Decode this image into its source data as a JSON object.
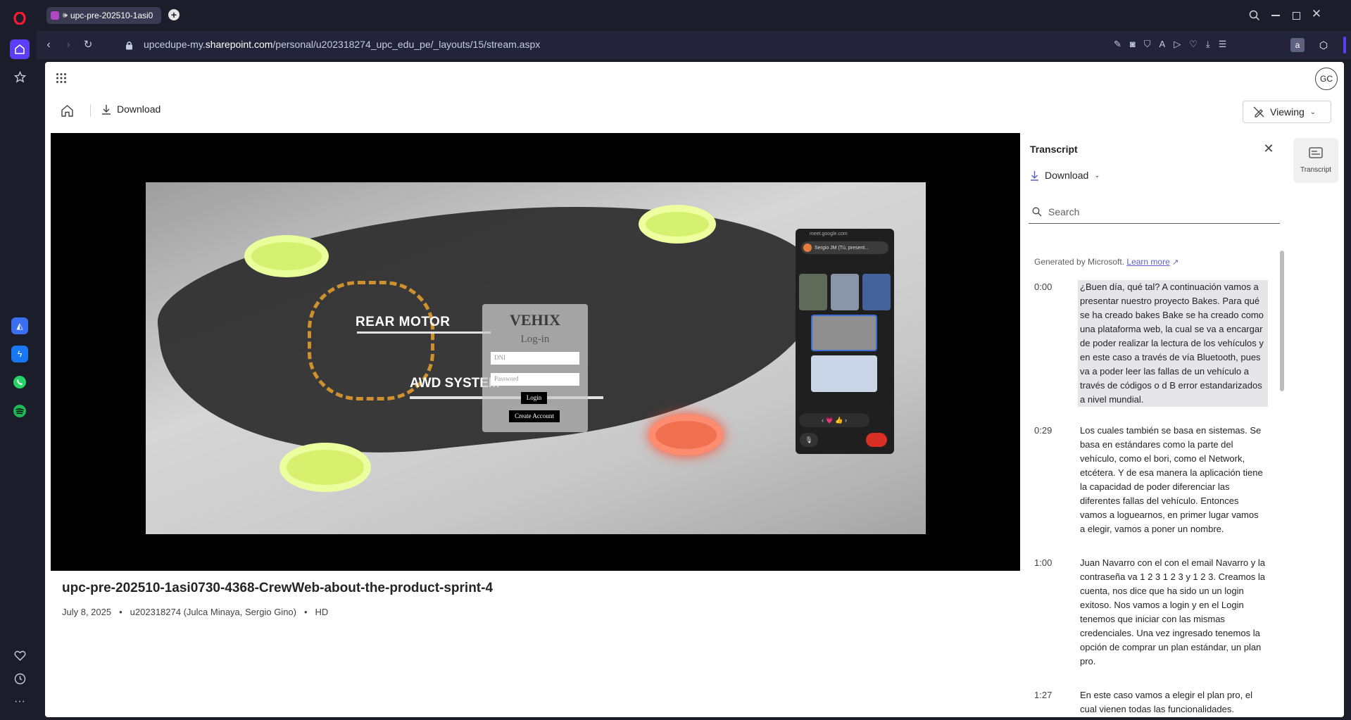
{
  "browser": {
    "tab_title": "upc-pre-202510-1asi0",
    "url_pre": "upcedupe-my.",
    "url_host": "sharepoint.com",
    "url_post": "/personal/u202318274_upc_edu_pe/_layouts/15/stream.aspx",
    "profile_badge": "a"
  },
  "app": {
    "user_initials": "GC",
    "download_label": "Download",
    "viewing_label": "Viewing",
    "transcript_rail_label": "Transcript"
  },
  "video": {
    "title": "upc-pre-202510-1asi0730-4368-CrewWeb-about-the-product-sprint-4",
    "date": "July 8, 2025",
    "owner": "u202318274 (Julca Minaya, Sergio Gino)",
    "quality": "HD",
    "frame": {
      "rear_motor": "REAR MOTOR",
      "awd": "AWD SYSTEM",
      "login_brand": "VEHIX",
      "login_heading": "Log-in",
      "dni_placeholder": "DNI",
      "password_placeholder": "Password",
      "login_button": "Login",
      "create_button": "Create Account",
      "meet_url": "meet.google.com",
      "meet_presenter": "Sergio JM (Tú, present..."
    }
  },
  "transcript": {
    "title": "Transcript",
    "download_label": "Download",
    "search_placeholder": "Search",
    "generated_by": "Generated by Microsoft.",
    "learn_more": "Learn more",
    "segments": [
      {
        "time": "0:00",
        "text": "¿Buen día, qué tal? A continuación vamos a presentar nuestro proyecto Bakes. Para qué se ha creado bakes Bake se ha creado como una plataforma web, la cual se va a encargar de poder realizar la lectura de los vehículos y en este caso a través de vía Bluetooth, pues va a poder leer las fallas de un vehículo a través de códigos o d B error estandarizados a nivel mundial."
      },
      {
        "time": "0:29",
        "text": "Los cuales también se basa en sistemas. Se basa en estándares como la parte del vehículo, como el bori, como el Network, etcétera. Y de esa manera la aplicación tiene la capacidad de poder diferenciar las diferentes fallas del vehículo. Entonces vamos a loguearnos, en primer lugar vamos a elegir, vamos a poner un nombre."
      },
      {
        "time": "1:00",
        "text": "Juan Navarro con el con el email Navarro y la contraseña va 1 2 3 1 2 3 y 1 2 3. Creamos la cuenta, nos dice que ha sido un un login exitoso. Nos vamos a login y en el Login tenemos que iniciar con las mismas credenciales. Una vez ingresado tenemos la opción de comprar un plan estándar, un plan pro."
      },
      {
        "time": "1:27",
        "text": "En este caso vamos a elegir el plan pro, el cual vienen todas las funcionalidades."
      }
    ]
  }
}
